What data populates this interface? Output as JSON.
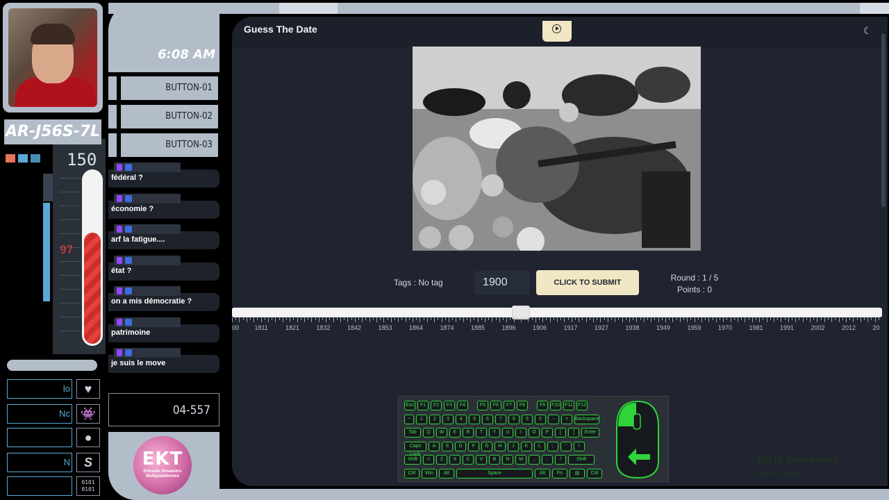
{
  "overlay": {
    "clock": "6:08 AM",
    "station_id": "AR-J56S-7L",
    "buttons": [
      "BUTTON-01",
      "BUTTON-02",
      "BUTTON-03"
    ],
    "gauge_max": "150",
    "gauge_value": "97",
    "code": "04-557",
    "side_labels": [
      "lo",
      "Nc",
      "",
      "N",
      "0101\n0101"
    ],
    "logo_text": "EKT",
    "logo_subtext": "Entraide Streamers Multiplateformes",
    "accent_color": "#b3bcc9",
    "gauge_color": "#e6403c"
  },
  "chat": {
    "messages": [
      {
        "text": "fédéral ?"
      },
      {
        "text": "économie ?"
      },
      {
        "text": "arf la fatigue...."
      },
      {
        "text": "état ?"
      },
      {
        "text": "on a mis démocratie ?"
      },
      {
        "text": "patrimoine"
      },
      {
        "text": "je suis le move"
      }
    ]
  },
  "app": {
    "title": "Guess The Date",
    "tags_label": "Tags : No tag",
    "year_value": "1900",
    "submit_label": "CLICK TO SUBMIT",
    "round_label": "Round : 1 / 5",
    "points_label": "Points : 0",
    "slider_value": 1900,
    "ruler_labels": [
      "00",
      "1811",
      "1821",
      "1832",
      "1842",
      "1853",
      "1864",
      "1874",
      "1885",
      "1896",
      "1906",
      "1917",
      "1927",
      "1938",
      "1949",
      "1959",
      "1970",
      "1981",
      "1991",
      "2002",
      "2012",
      "20"
    ],
    "primary_button_color": "#f1e7c4"
  },
  "keyboard": {
    "rows": [
      [
        "Esc",
        "F1",
        "F2",
        "F3",
        "F4",
        "F5",
        "F6",
        "F7",
        "F8",
        "F9",
        "F10",
        "F11",
        "F12"
      ],
      [
        "~",
        "1",
        "2",
        "3",
        "4",
        "5",
        "6",
        "7",
        "8",
        "9",
        "0",
        "-",
        "=",
        "Backspace"
      ],
      [
        "Tab",
        "Q",
        "W",
        "E",
        "R",
        "T",
        "Y",
        "U",
        "I",
        "O",
        "P",
        "[",
        "]",
        "Enter"
      ],
      [
        "Caps Lock",
        "A",
        "S",
        "D",
        "F",
        "G",
        "H",
        "J",
        "K",
        "L",
        ";",
        "'",
        "\\"
      ],
      [
        "Shift",
        "<",
        "Z",
        "X",
        "C",
        "V",
        "B",
        "N",
        "M",
        ",",
        ".",
        "/",
        "Shift"
      ],
      [
        "Ctrl",
        "Win",
        "Alt",
        "Space",
        "Alt",
        "Fn",
        "▤",
        "Ctrl"
      ]
    ]
  },
  "now_playing": {
    "title": "(2016 Remaster)",
    "artist": "Black Sabbath"
  }
}
